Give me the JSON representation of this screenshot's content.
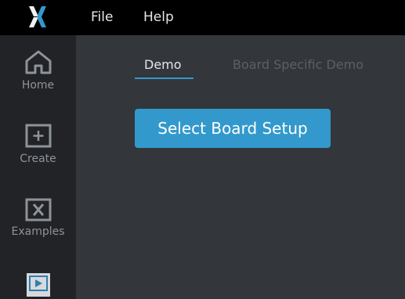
{
  "colors": {
    "topbar_bg": "#000000",
    "sidebar_bg": "#212326",
    "content_bg": "#33363b",
    "accent": "#3399cc",
    "logo_white": "#f1f1f1"
  },
  "menu": {
    "file": "File",
    "help": "Help"
  },
  "sidebar": {
    "items": [
      {
        "label": "Home",
        "icon": "home-icon"
      },
      {
        "label": "Create",
        "icon": "plus-square-icon"
      },
      {
        "label": "Examples",
        "icon": "x-square-icon"
      },
      {
        "label": "",
        "icon": "play-square-icon"
      }
    ]
  },
  "tabs": [
    {
      "label": "Demo",
      "active": true
    },
    {
      "label": "Board Specific Demo",
      "active": false
    }
  ],
  "main": {
    "primary_button": "Select Board Setup"
  }
}
